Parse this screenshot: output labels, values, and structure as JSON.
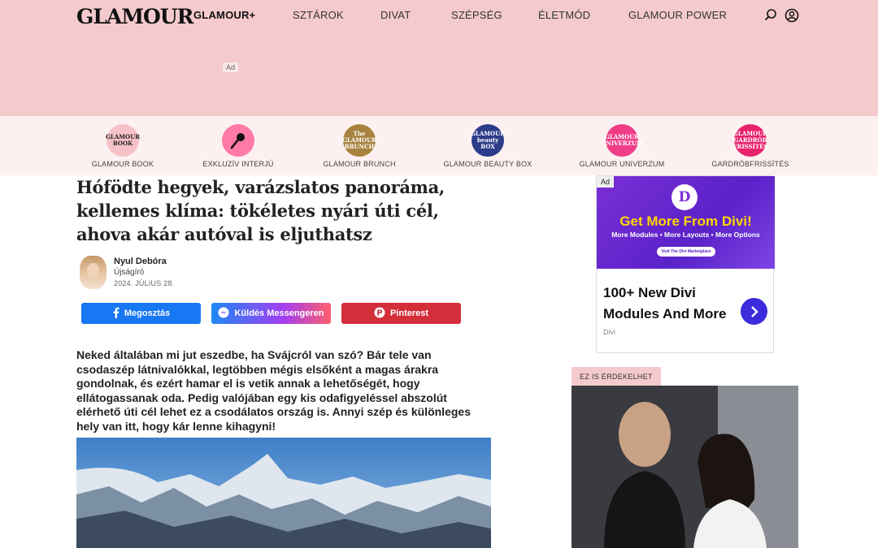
{
  "header": {
    "logo": "GLAMOUR",
    "nav": [
      "GLAMOUR+",
      "SZTÁROK",
      "DIVAT",
      "SZÉPSÉG",
      "ÉLETMÓD",
      "GLAMOUR POWER"
    ],
    "ad_label": "Ad"
  },
  "categories": [
    {
      "label": "GLAMOUR BOOK",
      "badge": "GLAMOUR BOOK",
      "color": "#f6c2c8",
      "text_color": "#222"
    },
    {
      "label": "EXKLUZÍV INTERJÚ",
      "badge": "",
      "color": "#ff7aa7",
      "text_color": "#fff"
    },
    {
      "label": "GLAMOUR BRUNCH",
      "badge": "The GLAMOUR BRUNCH",
      "color": "#a8823f",
      "text_color": "#fff"
    },
    {
      "label": "GLAMOUR BEAUTY BOX",
      "badge": "GLAMOUR beauty BOX",
      "color": "#2c3c8a",
      "text_color": "#fff"
    },
    {
      "label": "GLAMOUR UNIVERZUM",
      "badge": "GLAMOUR UNIVERZUM",
      "color": "#ef3d88",
      "text_color": "#fff"
    },
    {
      "label": "GARDRÓBFRISSÍTÉS",
      "badge": "GLAMOUR GARDRÓB FRISSÍTÉS",
      "color": "#e8226e",
      "text_color": "#fff"
    }
  ],
  "article": {
    "title": "Hófödte hegyek, varázslatos panoráma, kellemes klíma: tökéletes nyári úti cél, ahova akár autóval is eljuthatsz",
    "author_name": "Nyul Debóra",
    "author_role": "Újságíró",
    "date": "2024. JÚLIUS 28.",
    "lead": "Neked általában mi jut eszedbe, ha Svájcról van szó? Bár tele van csodaszép látnivalókkal, legtöbben mégis elsőként a magas árakra gondolnak, és ezért hamar el is vetik annak a lehetőségét, hogy ellátogassanak oda. Pedig valójában egy kis odafigyeléssel abszolút elérhető úti cél lehet ez a csodálatos ország is. Annyi szép és különleges hely van itt, hogy kár lenne kihagyni!"
  },
  "share": {
    "facebook": "Megosztás",
    "messenger": "Küldés Messengeren",
    "pinterest": "Pinterest",
    "facebook_color": "#1877f2",
    "pinterest_color": "#d32f3a"
  },
  "side_ad": {
    "badge": "Ad",
    "logo_letter": "D",
    "headline": "Get More From Divi!",
    "subline": "More Modules • More Layouts • More Options",
    "cta": "Visit The Divi Marketplace",
    "copy": "100+ New Divi Modules And More",
    "brand": "Divi"
  },
  "sidebar": {
    "interest_label": "EZ IS ÉRDEKELHET"
  }
}
